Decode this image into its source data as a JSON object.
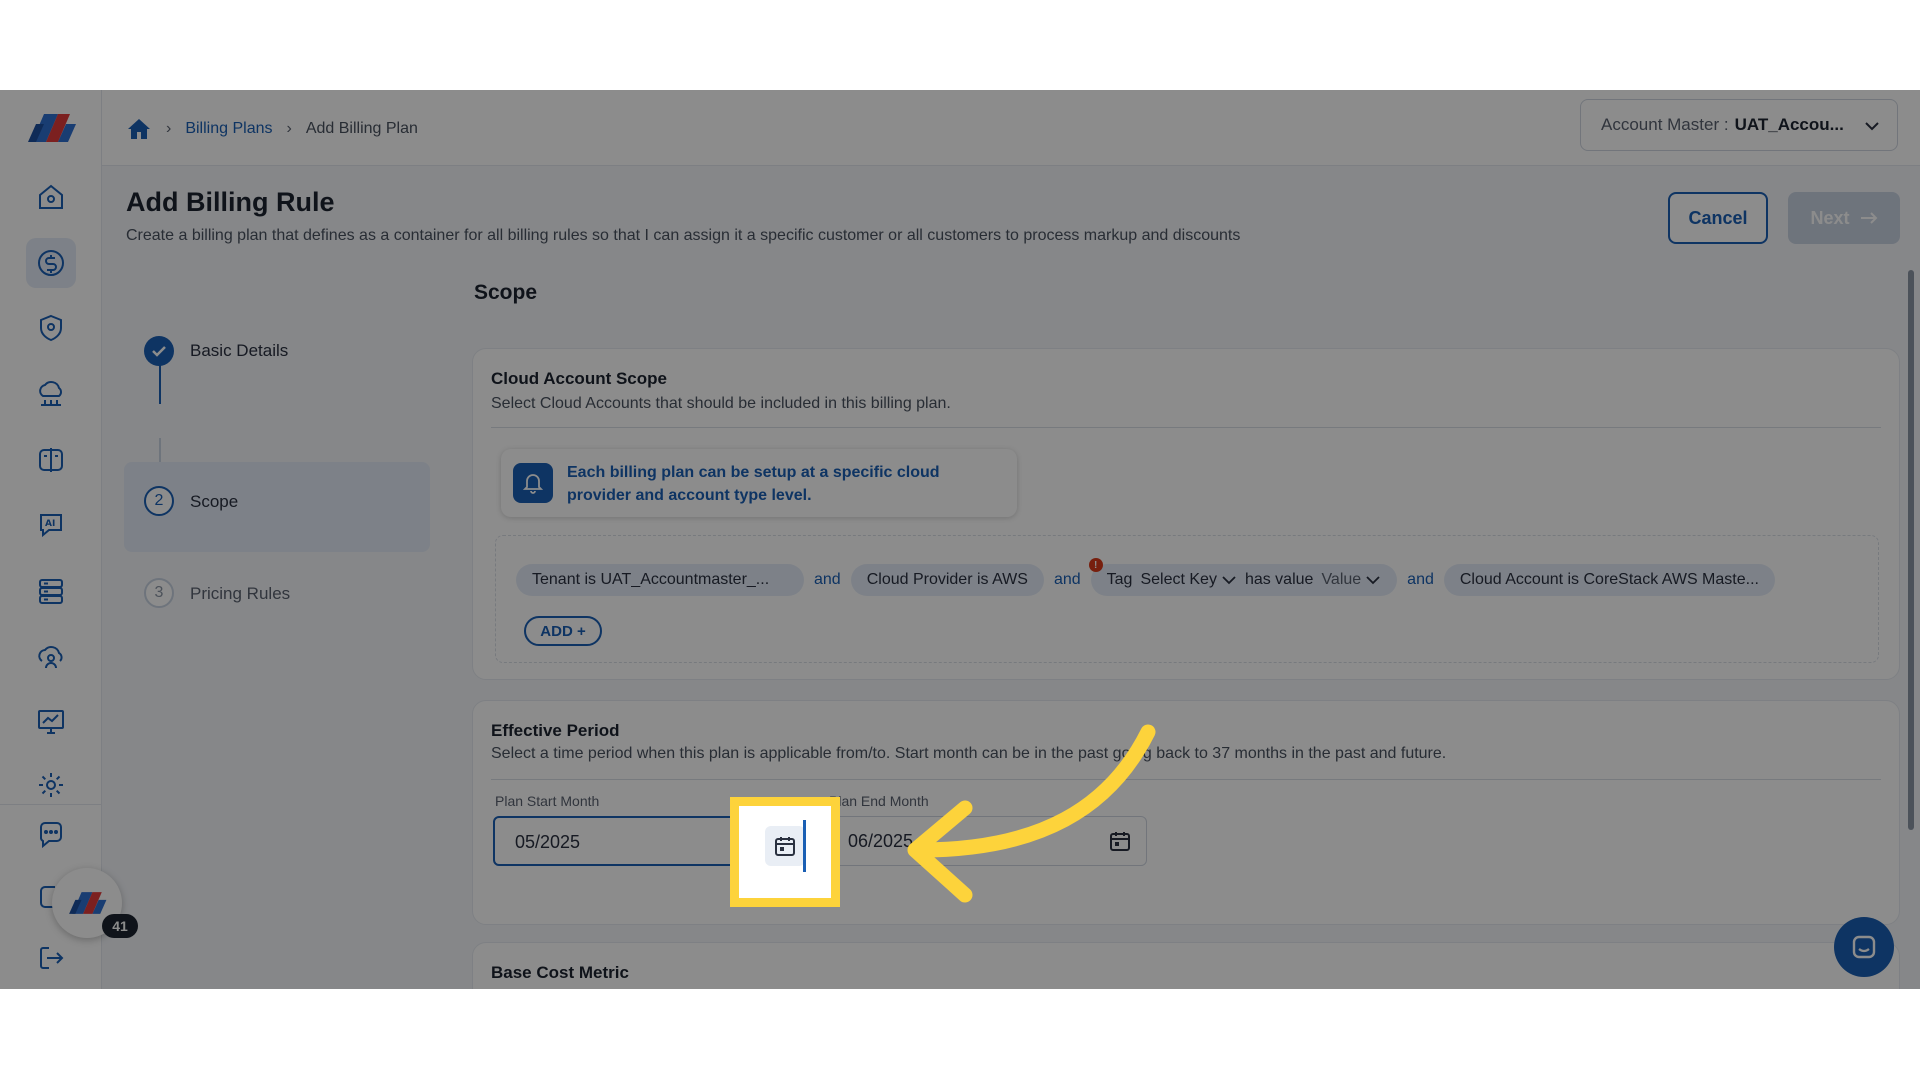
{
  "breadcrumb": {
    "home_icon": "home-icon",
    "items": [
      "Billing Plans",
      "Add Billing Plan"
    ]
  },
  "account": {
    "label": "Account Master :",
    "value": "UAT_Accou..."
  },
  "page": {
    "title": "Add Billing Rule",
    "description": "Create a billing plan that defines as a container for all billing rules so that I can assign it a specific customer or all customers to process markup and discounts"
  },
  "actions": {
    "cancel": "Cancel",
    "next": "Next"
  },
  "steps": [
    {
      "number": "",
      "label": "Basic Details",
      "state": "done"
    },
    {
      "number": "2",
      "label": "Scope",
      "state": "active"
    },
    {
      "number": "3",
      "label": "Pricing Rules",
      "state": "pending"
    }
  ],
  "section_title": "Scope",
  "cloud_scope": {
    "title": "Cloud Account Scope",
    "description": "Select Cloud Accounts that should be included in this billing plan.",
    "info": "Each billing plan can be setup at a specific cloud provider and account type level.",
    "chips": {
      "tenant": "Tenant is UAT_Accountmaster_...",
      "provider": "Cloud Provider is AWS",
      "tag_prefix": "Tag",
      "tag_key": "Select Key",
      "tag_mid": "has value",
      "tag_value": "Value",
      "account": "Cloud Account is CoreStack AWS Maste..."
    },
    "conjunction": "and",
    "warn_mark": "!",
    "add_label": "ADD +"
  },
  "effective_period": {
    "title": "Effective Period",
    "description": "Select a time period when this plan is applicable from/to. Start month can be in the past going back to 37 months in the past and future.",
    "start_label": "Plan Start Month",
    "start_value": "05/2025",
    "end_label": "Plan End Month",
    "end_value": "06/2025"
  },
  "base_cost": {
    "title": "Base Cost Metric"
  },
  "notification_count": "41",
  "colors": {
    "primary": "#1a5fb4",
    "highlight": "#fdd33b",
    "chip": "#e4ecf7"
  },
  "icons": {
    "sidebar": [
      "home-icon",
      "billing-icon",
      "shield-icon",
      "cloud-network-icon",
      "split-view-icon",
      "ai-chat-icon",
      "server-icon",
      "cloud-user-icon",
      "monitor-chart-icon",
      "settings-icon",
      "support-chat-icon",
      "help-icon",
      "logout-icon"
    ]
  }
}
